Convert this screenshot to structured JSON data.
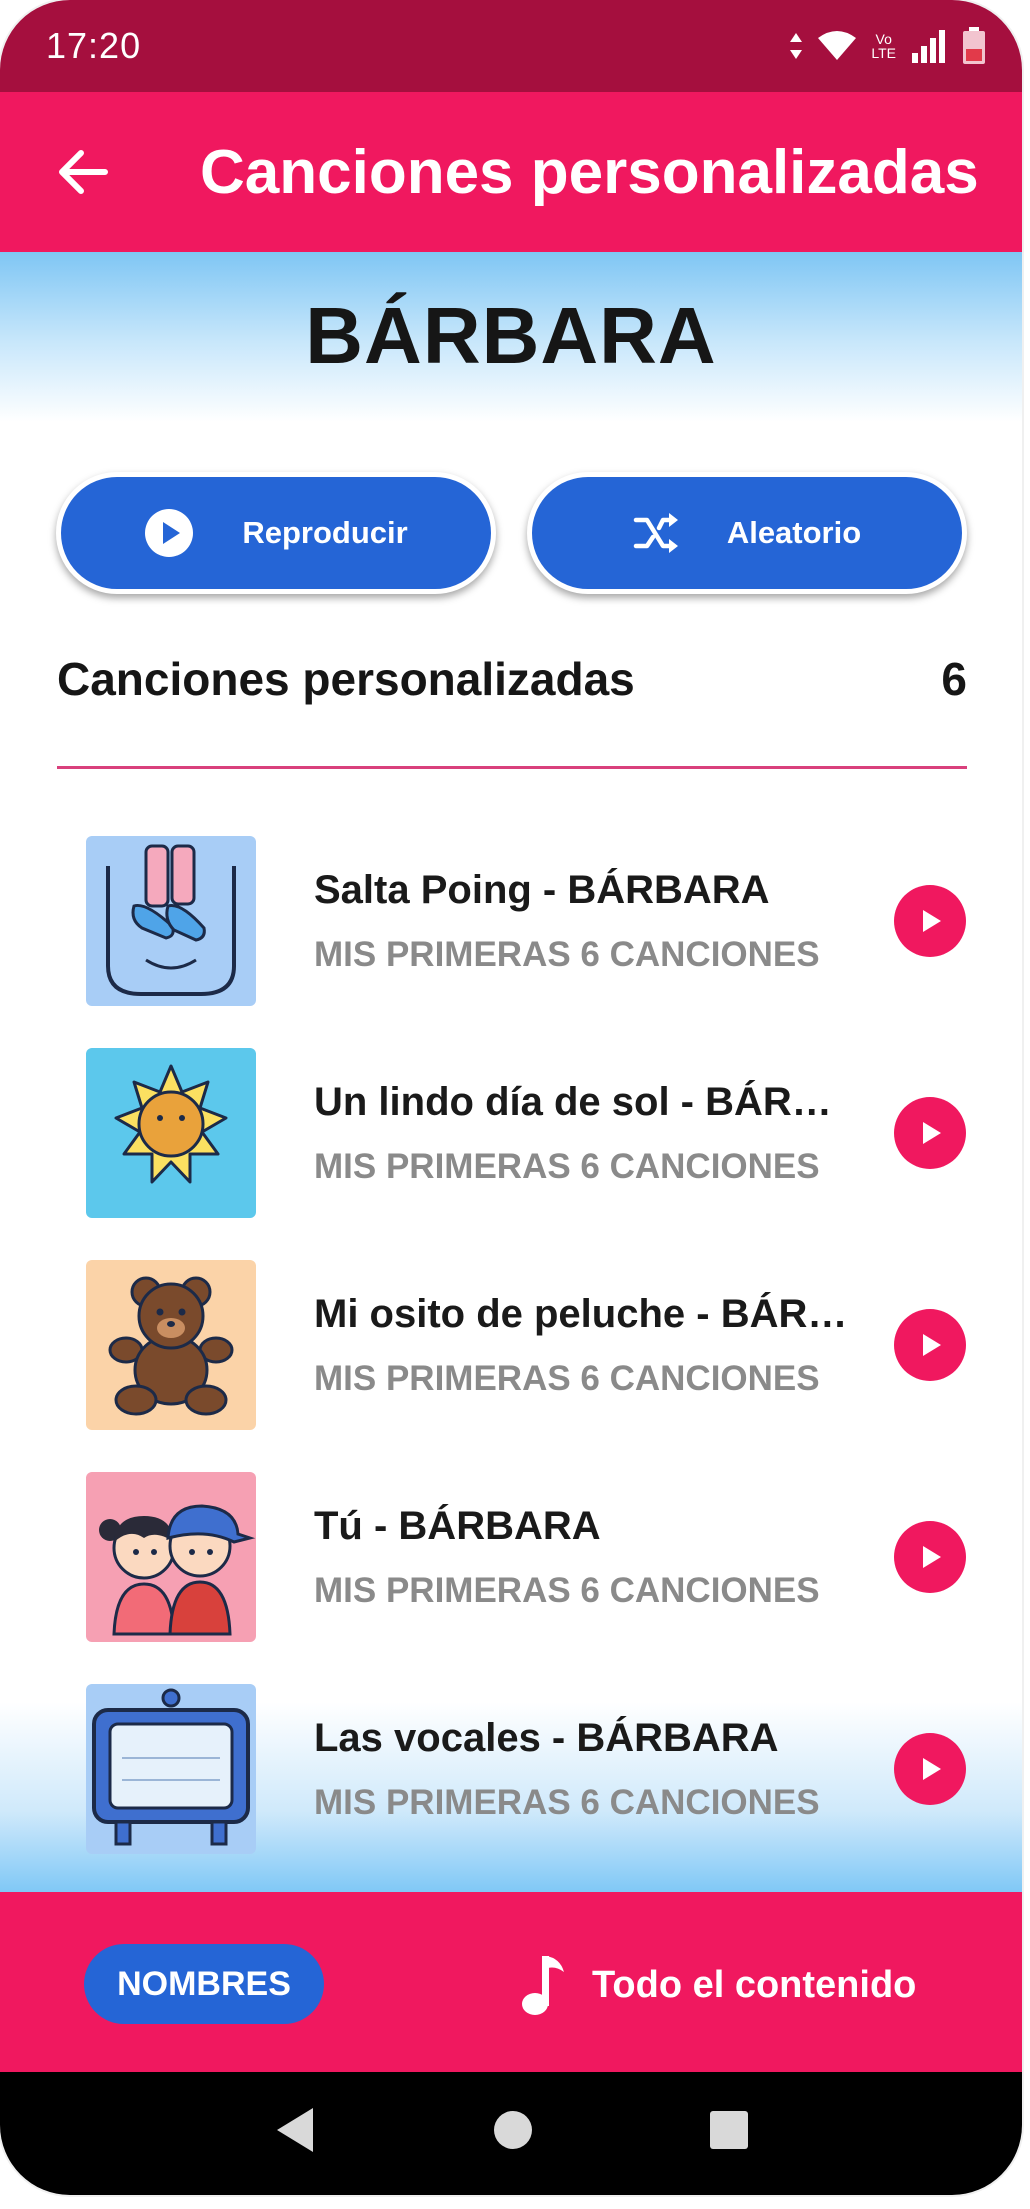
{
  "status_bar": {
    "time": "17:20",
    "volte_line1": "Vo",
    "volte_line2": "LTE"
  },
  "app_bar": {
    "title": "Canciones personalizadas"
  },
  "header": {
    "name": "BÁRBARA"
  },
  "actions": {
    "play_label": "Reproducir",
    "shuffle_label": "Aleatorio"
  },
  "section": {
    "title": "Canciones personalizadas",
    "count": "6"
  },
  "songs": [
    {
      "title": "Salta Poing - BÁRBARA",
      "album": "MIS PRIMERAS 6 CANCIONES",
      "art": "jumping-shoes-icon"
    },
    {
      "title": "Un lindo día de sol - BÁRBARA",
      "album": "MIS PRIMERAS 6 CANCIONES",
      "art": "sun-icon"
    },
    {
      "title": "Mi osito de peluche - BÁRBARA",
      "album": "MIS PRIMERAS 6 CANCIONES",
      "art": "teddy-bear-icon"
    },
    {
      "title": "Tú - BÁRBARA",
      "album": "MIS PRIMERAS 6 CANCIONES",
      "art": "kids-icon"
    },
    {
      "title": "Las vocales - BÁRBARA",
      "album": "MIS PRIMERAS 6 CANCIONES",
      "art": "vowels-tv-icon"
    }
  ],
  "bottom_bar": {
    "names_label": "NOMBRES",
    "all_content_label": "Todo el contenido"
  },
  "colors": {
    "status_bar": "#a50f3e",
    "accent": "#f0185f",
    "button_blue": "#2565d6"
  }
}
